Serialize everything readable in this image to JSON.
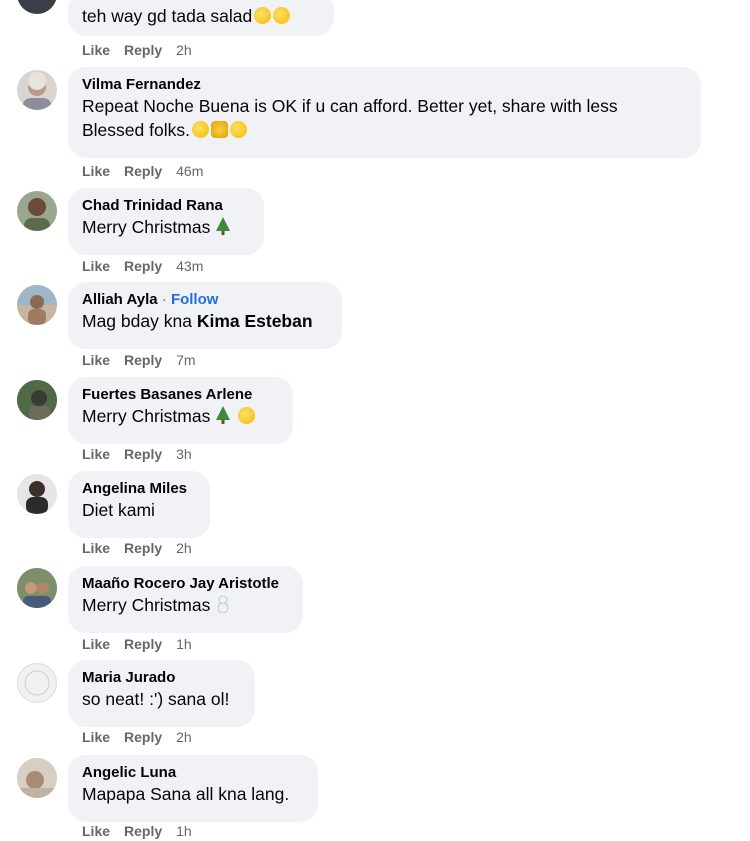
{
  "comments": [
    {
      "name": "",
      "text": "teh way gd tada salad",
      "actions": {
        "like": "Like",
        "reply": "Reply",
        "time": "2h"
      }
    },
    {
      "name": "Vilma Fernandez",
      "text_line1": "Repeat Noche Buena is OK if u can afford. Better yet, share with less",
      "text_line2": "Blessed folks.",
      "actions": {
        "like": "Like",
        "reply": "Reply",
        "time": "46m"
      }
    },
    {
      "name": "Chad Trinidad Rana",
      "text": "Merry Christmas",
      "actions": {
        "like": "Like",
        "reply": "Reply",
        "time": "43m"
      }
    },
    {
      "name": "Alliah Ayla",
      "follow": "Follow",
      "dot": "·",
      "text_prefix": "Mag bday kna",
      "mention": "Kima Esteban",
      "actions": {
        "like": "Like",
        "reply": "Reply",
        "time": "7m"
      }
    },
    {
      "name": "Fuertes Basanes Arlene",
      "text": "Merry Christmas",
      "actions": {
        "like": "Like",
        "reply": "Reply",
        "time": "3h"
      }
    },
    {
      "name": "Angelina Miles",
      "text": "Diet kami",
      "actions": {
        "like": "Like",
        "reply": "Reply",
        "time": "2h"
      }
    },
    {
      "name": "Maaño Rocero Jay Aristotle",
      "text": "Merry Christmas",
      "actions": {
        "like": "Like",
        "reply": "Reply",
        "time": "1h"
      }
    },
    {
      "name": "Maria Jurado",
      "text": "so neat! :') sana ol!",
      "actions": {
        "like": "Like",
        "reply": "Reply",
        "time": "2h"
      }
    },
    {
      "name": "Angelic Luna",
      "text": "Mapapa Sana all kna lang.",
      "actions": {
        "like": "Like",
        "reply": "Reply",
        "time": "1h"
      }
    }
  ]
}
